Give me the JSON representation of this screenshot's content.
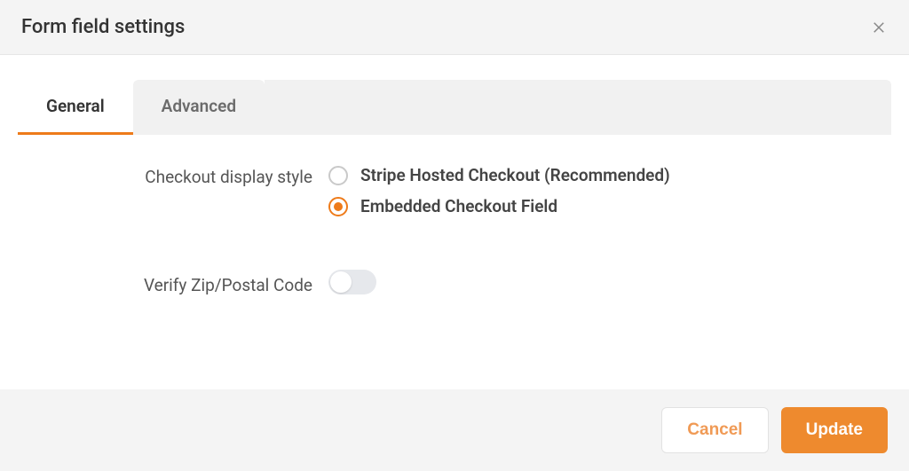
{
  "modal": {
    "title": "Form field settings"
  },
  "tabs": {
    "general": "General",
    "advanced": "Advanced",
    "active": "general"
  },
  "fields": {
    "checkout_display_style": {
      "label": "Checkout display style",
      "options": {
        "hosted": "Stripe Hosted Checkout (Recommended)",
        "embedded": "Embedded Checkout Field"
      },
      "selected": "embedded"
    },
    "verify_zip": {
      "label": "Verify Zip/Postal Code",
      "value": false
    }
  },
  "footer": {
    "cancel": "Cancel",
    "update": "Update"
  }
}
